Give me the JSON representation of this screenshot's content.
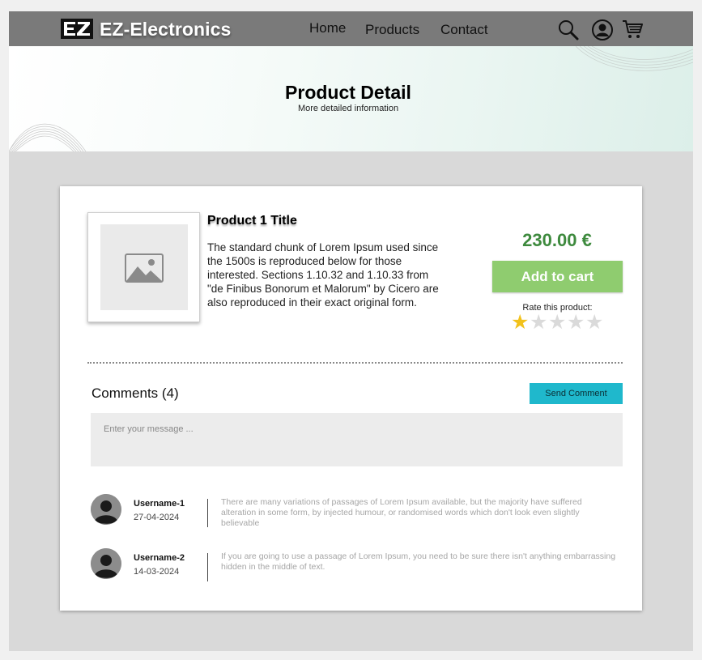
{
  "header": {
    "brand": "EZ-Electronics",
    "logo_text": "EZ",
    "nav": [
      {
        "label": "Home"
      },
      {
        "label": "Products"
      },
      {
        "label": "Contact"
      }
    ],
    "icons": [
      "search-icon",
      "user-icon",
      "cart-icon"
    ],
    "background_color": "#7a7a7a"
  },
  "hero": {
    "title": "Product Detail",
    "subtitle": "More detailed information"
  },
  "product": {
    "title": "Product 1 Title",
    "description": "The standard chunk of Lorem Ipsum used since the 1500s is reproduced below for those interested. Sections 1.10.32 and 1.10.33 from \"de Finibus Bonorum et Malorum\" by Cicero are also reproduced in their exact original form.",
    "price": "230.00 €",
    "price_color": "#3e8a3e",
    "add_to_cart_label": "Add to cart",
    "add_to_cart_color": "#8fcc6f",
    "rate_label": "Rate this product:",
    "rating": 1,
    "rating_max": 5,
    "image_icon": "image-placeholder-icon"
  },
  "comments": {
    "title": "Comments (4)",
    "send_label": "Send Comment",
    "send_color": "#1fb8cc",
    "input_placeholder": "Enter your message ...",
    "items": [
      {
        "username": "Username-1",
        "date": "27-04-2024",
        "text": "There are many variations of passages of Lorem Ipsum available, but the majority have suffered alteration in some form, by injected humour, or randomised words which don't look even slightly believable"
      },
      {
        "username": "Username-2",
        "date": "14-03-2024",
        "text": "If you are going to use a passage of Lorem Ipsum, you need to be sure there isn't anything embarrassing hidden in the middle of text."
      }
    ]
  }
}
